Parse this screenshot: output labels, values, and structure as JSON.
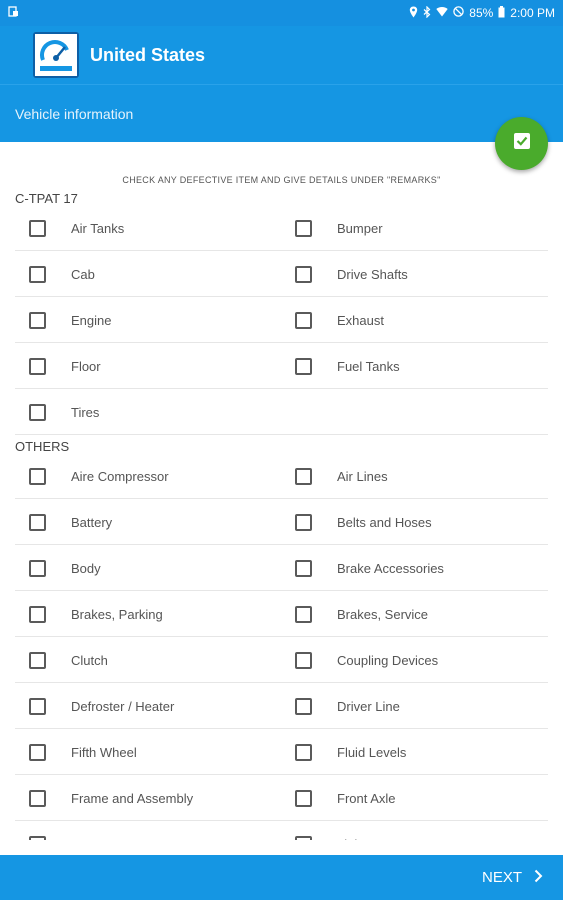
{
  "status_bar": {
    "battery": "85%",
    "time": "2:00 PM"
  },
  "app_bar": {
    "title": "United States"
  },
  "sub_bar": {
    "title": "Vehicle information"
  },
  "instructions": "CHECK ANY DEFECTIVE ITEM AND GIVE DETAILS UNDER \"REMARKS\"",
  "sections": {
    "ctpat": {
      "title": "C-TPAT 17",
      "rows": [
        [
          "Air Tanks",
          "Bumper"
        ],
        [
          "Cab",
          "Drive Shafts"
        ],
        [
          "Engine",
          "Exhaust"
        ],
        [
          "Floor",
          "Fuel Tanks"
        ],
        [
          "Tires",
          ""
        ]
      ]
    },
    "others": {
      "title": "OTHERS",
      "rows": [
        [
          "Aire Compressor",
          "Air Lines"
        ],
        [
          "Battery",
          "Belts and Hoses"
        ],
        [
          "Body",
          "Brake Accessories"
        ],
        [
          "Brakes, Parking",
          "Brakes, Service"
        ],
        [
          "Clutch",
          "Coupling Devices"
        ],
        [
          "Defroster / Heater",
          "Driver Line"
        ],
        [
          "Fifth Wheel",
          "Fluid Levels"
        ],
        [
          "Frame and Assembly",
          "Front Axle"
        ],
        [
          "Horn",
          "Lights"
        ]
      ]
    }
  },
  "bottom_bar": {
    "next_label": "NEXT"
  },
  "colors": {
    "primary": "#1596e3",
    "accent": "#4aab2c"
  }
}
